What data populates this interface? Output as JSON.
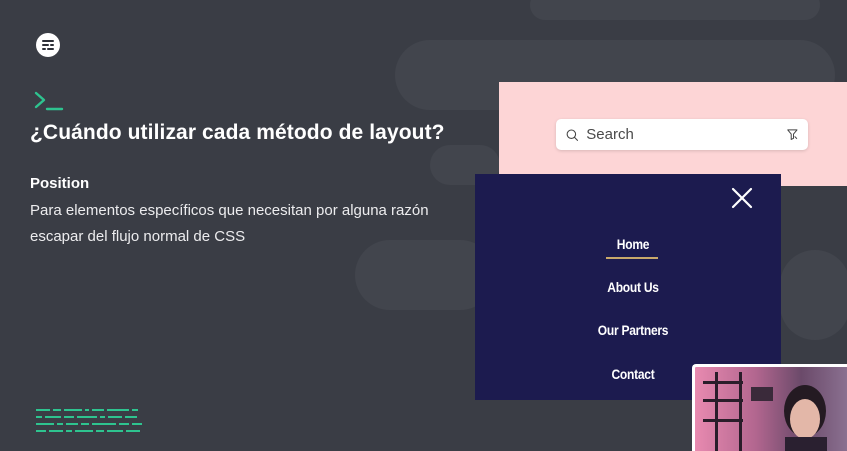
{
  "slide": {
    "title": "¿Cuándo utilizar cada método de layout?",
    "section_label": "Position",
    "description": "Para elementos específicos que necesitan por alguna razón escapar del flujo normal de CSS"
  },
  "icons": {
    "logo": "stacked-lines-logo",
    "prompt": "terminal-prompt-icon",
    "search": "search-icon",
    "filter": "funnel-icon",
    "close": "close-icon"
  },
  "search": {
    "placeholder": "Search"
  },
  "nav_menu": {
    "items": [
      {
        "label": "Home",
        "active": true
      },
      {
        "label": "About Us"
      },
      {
        "label": "Our Partners"
      },
      {
        "label": "Contact"
      }
    ]
  },
  "colors": {
    "background": "#3a3d45",
    "accent_green": "#2ec38f",
    "nav_panel": "#1c1b4f",
    "pink_panel": "#fdd5d6",
    "nav_active_underline": "#c9a96b"
  }
}
